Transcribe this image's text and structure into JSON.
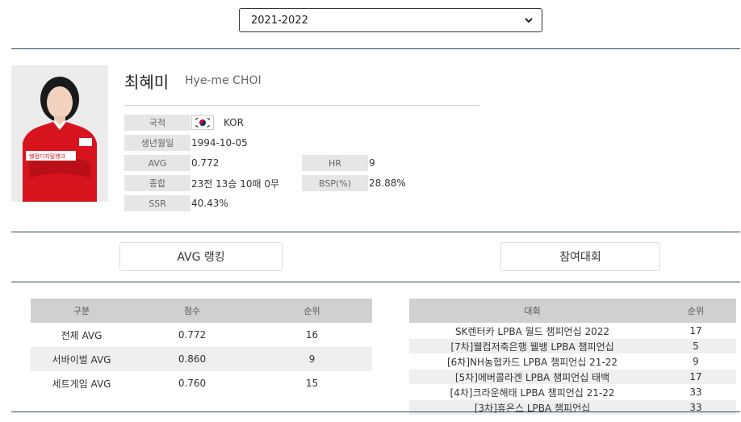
{
  "season": {
    "selected": "2021-2022"
  },
  "player": {
    "name_ko": "최혜미",
    "name_en": "Hye-me CHOI",
    "photo_icon": "player-photo",
    "stats": {
      "nationality_label": "국적",
      "nationality_value": "KOR",
      "flag_icon": "korea-flag-icon",
      "birth_label": "생년월일",
      "birth_value": "1994-10-05",
      "avg_label": "AVG",
      "avg_value": "0.772",
      "hr_label": "HR",
      "hr_value": "9",
      "record_label": "종합",
      "record_value": "23전 13승 10패 0무",
      "bsp_label": "BSP(%)",
      "bsp_value": "28.88%",
      "ssr_label": "SSR",
      "ssr_value": "40.43%"
    }
  },
  "tabs": {
    "avg_ranking": "AVG 랭킹",
    "tournaments": "참여대회"
  },
  "avg_table": {
    "headers": [
      "구분",
      "점수",
      "순위"
    ],
    "rows": [
      {
        "category": "전체 AVG",
        "score": "0.772",
        "rank": "16"
      },
      {
        "category": "서바이벌 AVG",
        "score": "0.860",
        "rank": "9"
      },
      {
        "category": "세트게임 AVG",
        "score": "0.760",
        "rank": "15"
      }
    ]
  },
  "tournament_table": {
    "headers": [
      "대회",
      "순위"
    ],
    "rows": [
      {
        "name": "SK렌터카 LPBA 월드 챔피언십 2022",
        "rank": "17"
      },
      {
        "name": "[7차]웰컴저축은행 웰뱅 LPBA 챔피언십",
        "rank": "5"
      },
      {
        "name": "[6차]NH농협카드 LPBA 챔피언십 21-22",
        "rank": "9"
      },
      {
        "name": "[5차]에버콜라겐 LPBA 챔피언십 태백",
        "rank": "17"
      },
      {
        "name": "[4차]크라운해태 LPBA 챔피언십 21-22",
        "rank": "33"
      },
      {
        "name": "[3차]휴온스 LPBA 챔피언십",
        "rank": "33"
      }
    ]
  },
  "colors": {
    "divider": "#2c4662",
    "jersey": "#d7141d",
    "label_bg": "#e6e6e6",
    "header_bg": "#d0d0d0"
  }
}
